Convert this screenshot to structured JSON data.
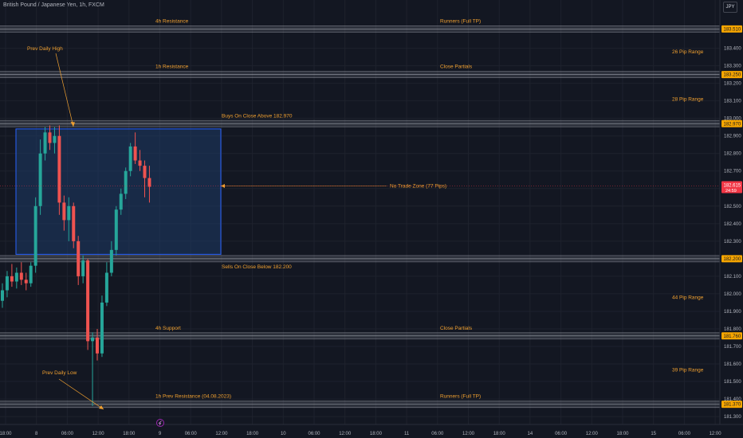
{
  "header": {
    "title": "British Pound / Japanese Yen, 1h, FXCM",
    "currency": "JPY"
  },
  "colors": {
    "background": "#131722",
    "up": "#26a69a",
    "down": "#ef5350",
    "annotation": "#f0a030",
    "price_badge": "#f7a600",
    "current_badge": "#f23645",
    "zone_fill": "#1e3a66",
    "zone_border": "#2962ff",
    "band": "#787b86"
  },
  "price_axis": {
    "min": 181.255,
    "max": 183.675,
    "ticks": [
      "183.400",
      "183.300",
      "183.200",
      "183.100",
      "183.000",
      "182.900",
      "182.800",
      "182.700",
      "182.600",
      "182.500",
      "182.400",
      "182.300",
      "182.200",
      "182.100",
      "182.000",
      "181.900",
      "181.800",
      "181.700",
      "181.600",
      "181.500",
      "181.400",
      "181.300"
    ],
    "current_price": "182.615",
    "countdown": "24:59"
  },
  "time_axis": {
    "labels": [
      "18:00",
      "8",
      "06:00",
      "12:00",
      "18:00",
      "9",
      "06:00",
      "12:00",
      "18:00",
      "10",
      "06:00",
      "12:00",
      "18:00",
      "11",
      "06:00",
      "12:00",
      "18:00",
      "14",
      "06:00",
      "12:00",
      "18:00",
      "15",
      "06:00",
      "12:00"
    ]
  },
  "levels": [
    {
      "price": 183.51,
      "label": "183.510",
      "left_text": "4h Resistance",
      "right_text": "Runners (Full TP)"
    },
    {
      "price": 183.25,
      "label": "183.250",
      "left_text": "1h Resistance",
      "right_text": "Close Partials"
    },
    {
      "price": 182.97,
      "label": "182.970",
      "left_text": "Buys On Close Above 182.970",
      "right_text": ""
    },
    {
      "price": 182.2,
      "label": "182.200",
      "left_text": "Sells On Close Below 182.200",
      "right_text": ""
    },
    {
      "price": 181.76,
      "label": "181.760",
      "left_text": "4h Support",
      "right_text": "Close Partials"
    },
    {
      "price": 181.37,
      "label": "181.370",
      "left_text": "1h Prev Resistance (04.08.2023)",
      "right_text": "Runners (Full TP)"
    }
  ],
  "pip_ranges": [
    {
      "text": "26 Pip Range",
      "price": 183.38
    },
    {
      "text": "28 Pip Range",
      "price": 183.11
    },
    {
      "text": "44 Pip Range",
      "price": 181.98
    },
    {
      "text": "39 Pip Range",
      "price": 181.565
    }
  ],
  "annotations": {
    "prev_daily_high": "Prev Daily High",
    "prev_daily_low": "Prev Daily Low",
    "no_trade_zone": "No Trade Zone (77 Pips)"
  },
  "zone": {
    "top": 182.94,
    "bottom": 182.225
  },
  "chart_data": {
    "type": "candlestick",
    "symbol": "British Pound / Japanese Yen, 1h, FXCM",
    "candles": [
      {
        "o": 181.96,
        "h": 182.06,
        "l": 181.92,
        "c": 182.02
      },
      {
        "o": 182.02,
        "h": 182.13,
        "l": 181.98,
        "c": 182.1
      },
      {
        "o": 182.1,
        "h": 182.17,
        "l": 182.04,
        "c": 182.07
      },
      {
        "o": 182.07,
        "h": 182.15,
        "l": 182.03,
        "c": 182.12
      },
      {
        "o": 182.12,
        "h": 182.18,
        "l": 182.05,
        "c": 182.08
      },
      {
        "o": 182.08,
        "h": 182.12,
        "l": 182.02,
        "c": 182.06
      },
      {
        "o": 182.06,
        "h": 182.18,
        "l": 182.04,
        "c": 182.16
      },
      {
        "o": 182.16,
        "h": 182.55,
        "l": 182.12,
        "c": 182.5
      },
      {
        "o": 182.5,
        "h": 182.88,
        "l": 182.45,
        "c": 182.8
      },
      {
        "o": 182.8,
        "h": 182.95,
        "l": 182.76,
        "c": 182.92
      },
      {
        "o": 182.92,
        "h": 182.96,
        "l": 182.82,
        "c": 182.86
      },
      {
        "o": 182.86,
        "h": 182.95,
        "l": 182.8,
        "c": 182.9
      },
      {
        "o": 182.9,
        "h": 182.96,
        "l": 182.45,
        "c": 182.52
      },
      {
        "o": 182.52,
        "h": 182.56,
        "l": 182.36,
        "c": 182.42
      },
      {
        "o": 182.42,
        "h": 182.55,
        "l": 182.3,
        "c": 182.5
      },
      {
        "o": 182.5,
        "h": 182.52,
        "l": 182.26,
        "c": 182.3
      },
      {
        "o": 182.3,
        "h": 182.33,
        "l": 182.05,
        "c": 182.1
      },
      {
        "o": 182.1,
        "h": 182.22,
        "l": 182.06,
        "c": 182.19
      },
      {
        "o": 182.19,
        "h": 182.2,
        "l": 181.68,
        "c": 181.73
      },
      {
        "o": 181.73,
        "h": 181.78,
        "l": 181.36,
        "c": 181.75
      },
      {
        "o": 181.75,
        "h": 181.8,
        "l": 181.62,
        "c": 181.66
      },
      {
        "o": 181.66,
        "h": 181.99,
        "l": 181.64,
        "c": 181.95
      },
      {
        "o": 181.95,
        "h": 182.18,
        "l": 181.93,
        "c": 182.12
      },
      {
        "o": 182.12,
        "h": 182.3,
        "l": 182.1,
        "c": 182.25
      },
      {
        "o": 182.25,
        "h": 182.5,
        "l": 182.22,
        "c": 182.48
      },
      {
        "o": 182.48,
        "h": 182.6,
        "l": 182.45,
        "c": 182.57
      },
      {
        "o": 182.57,
        "h": 182.72,
        "l": 182.54,
        "c": 182.7
      },
      {
        "o": 182.7,
        "h": 182.86,
        "l": 182.67,
        "c": 182.84
      },
      {
        "o": 182.84,
        "h": 182.92,
        "l": 182.74,
        "c": 182.76
      },
      {
        "o": 182.76,
        "h": 182.82,
        "l": 182.7,
        "c": 182.73
      },
      {
        "o": 182.73,
        "h": 182.76,
        "l": 182.55,
        "c": 182.66
      },
      {
        "o": 182.66,
        "h": 182.73,
        "l": 182.52,
        "c": 182.61
      }
    ]
  }
}
